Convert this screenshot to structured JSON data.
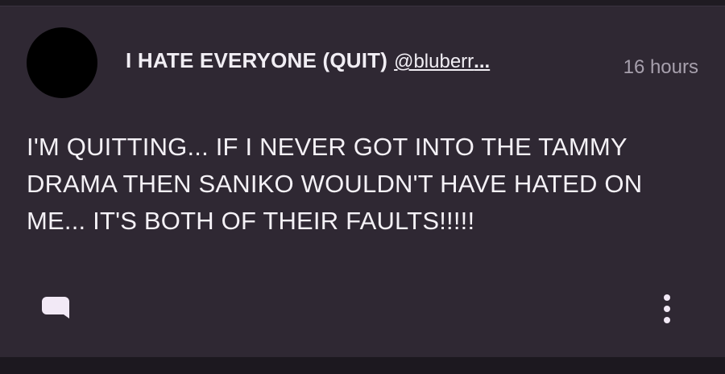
{
  "post": {
    "author": {
      "display_name": "I HATE EVERYONE (QUIT)",
      "handle": "@bluberr",
      "handle_truncation": "..."
    },
    "timestamp": "16 hours",
    "body": "I'M QUITTING... IF I NEVER GOT INTO THE TAMMY DRAMA THEN SANIKO WOULDN'T HAVE HATED ON ME... IT'S BOTH OF THEIR FAULTS!!!!!",
    "actions": {
      "reply_icon": "speech-bubble-icon",
      "more_icon": "vertical-dots-icon"
    }
  },
  "colors": {
    "background": "#1f1b22",
    "card": "#2f2833",
    "text": "#f4f1f6",
    "muted": "#a7a0ad",
    "avatar": "#000000",
    "icon": "#f2e9f6"
  }
}
